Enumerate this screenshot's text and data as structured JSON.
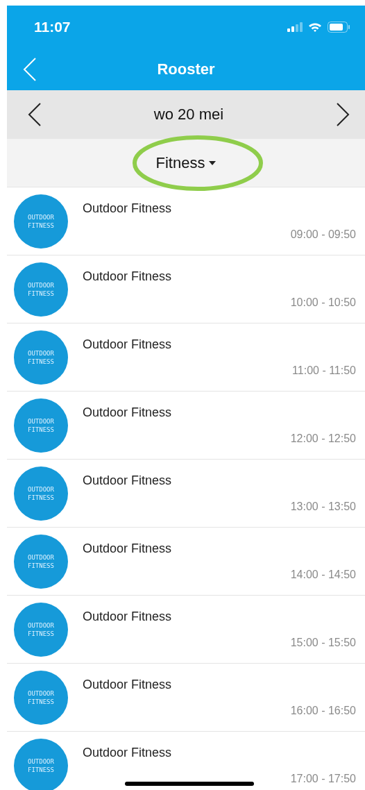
{
  "status_bar": {
    "time": "11:07"
  },
  "nav": {
    "title": "Rooster"
  },
  "date_bar": {
    "date": "wo 20 mei"
  },
  "filter": {
    "label": "Fitness",
    "highlighted": true
  },
  "classes": [
    {
      "title": "Outdoor Fitness",
      "time": "09:00 - 09:50",
      "logo": [
        "OUTDOOR",
        "FITNESS"
      ]
    },
    {
      "title": "Outdoor Fitness",
      "time": "10:00 - 10:50",
      "logo": [
        "OUTDOOR",
        "FITNESS"
      ]
    },
    {
      "title": "Outdoor Fitness",
      "time": "11:00 - 11:50",
      "logo": [
        "OUTDOOR",
        "FITNESS"
      ]
    },
    {
      "title": "Outdoor Fitness",
      "time": "12:00 - 12:50",
      "logo": [
        "OUTDOOR",
        "FITNESS"
      ]
    },
    {
      "title": "Outdoor Fitness",
      "time": "13:00 - 13:50",
      "logo": [
        "OUTDOOR",
        "FITNESS"
      ]
    },
    {
      "title": "Outdoor Fitness",
      "time": "14:00 - 14:50",
      "logo": [
        "OUTDOOR",
        "FITNESS"
      ]
    },
    {
      "title": "Outdoor Fitness",
      "time": "15:00 - 15:50",
      "logo": [
        "OUTDOOR",
        "FITNESS"
      ]
    },
    {
      "title": "Outdoor Fitness",
      "time": "16:00 - 16:50",
      "logo": [
        "OUTDOOR",
        "FITNESS"
      ]
    },
    {
      "title": "Outdoor Fitness",
      "time": "17:00 - 17:50",
      "logo": [
        "OUTDOOR",
        "FITNESS"
      ]
    }
  ]
}
